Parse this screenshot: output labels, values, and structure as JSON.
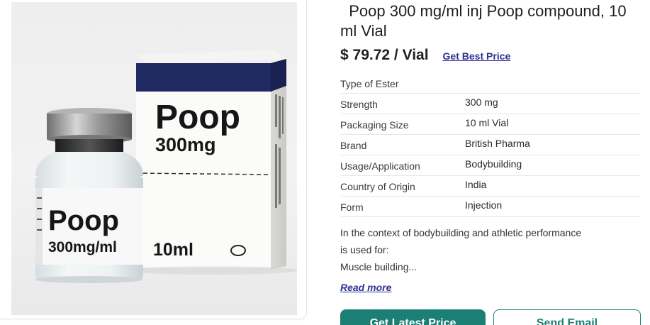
{
  "product": {
    "title": "  Poop 300 mg/ml inj Poop compound, 10 ml Vial",
    "price": "$ 79.72 / Vial",
    "best_price_label": "Get Best Price"
  },
  "image": {
    "box_brand": "Poop",
    "box_strength": "300mg",
    "box_volume": "10ml",
    "vial_brand": "Poop",
    "vial_strength": "300mg/ml"
  },
  "specs": [
    {
      "key": "Type of Ester",
      "value": ""
    },
    {
      "key": "Strength",
      "value": "300 mg"
    },
    {
      "key": "Packaging Size",
      "value": "10 ml Vial"
    },
    {
      "key": "Brand",
      "value": "British Pharma"
    },
    {
      "key": "Usage/Application",
      "value": "Bodybuilding"
    },
    {
      "key": "Country of Origin",
      "value": "India"
    },
    {
      "key": "Form",
      "value": "Injection"
    }
  ],
  "description": {
    "line1": "In the context of bodybuilding and athletic performance",
    "line2": "is used for:",
    "line3": "Muscle building..."
  },
  "read_more_label": "Read more",
  "buttons": {
    "latest_price": "Get Latest Price",
    "send_email": "Send Email"
  },
  "colors": {
    "accent": "#1b7f75",
    "link": "#2e3192",
    "box_band": "#1f2a63"
  }
}
